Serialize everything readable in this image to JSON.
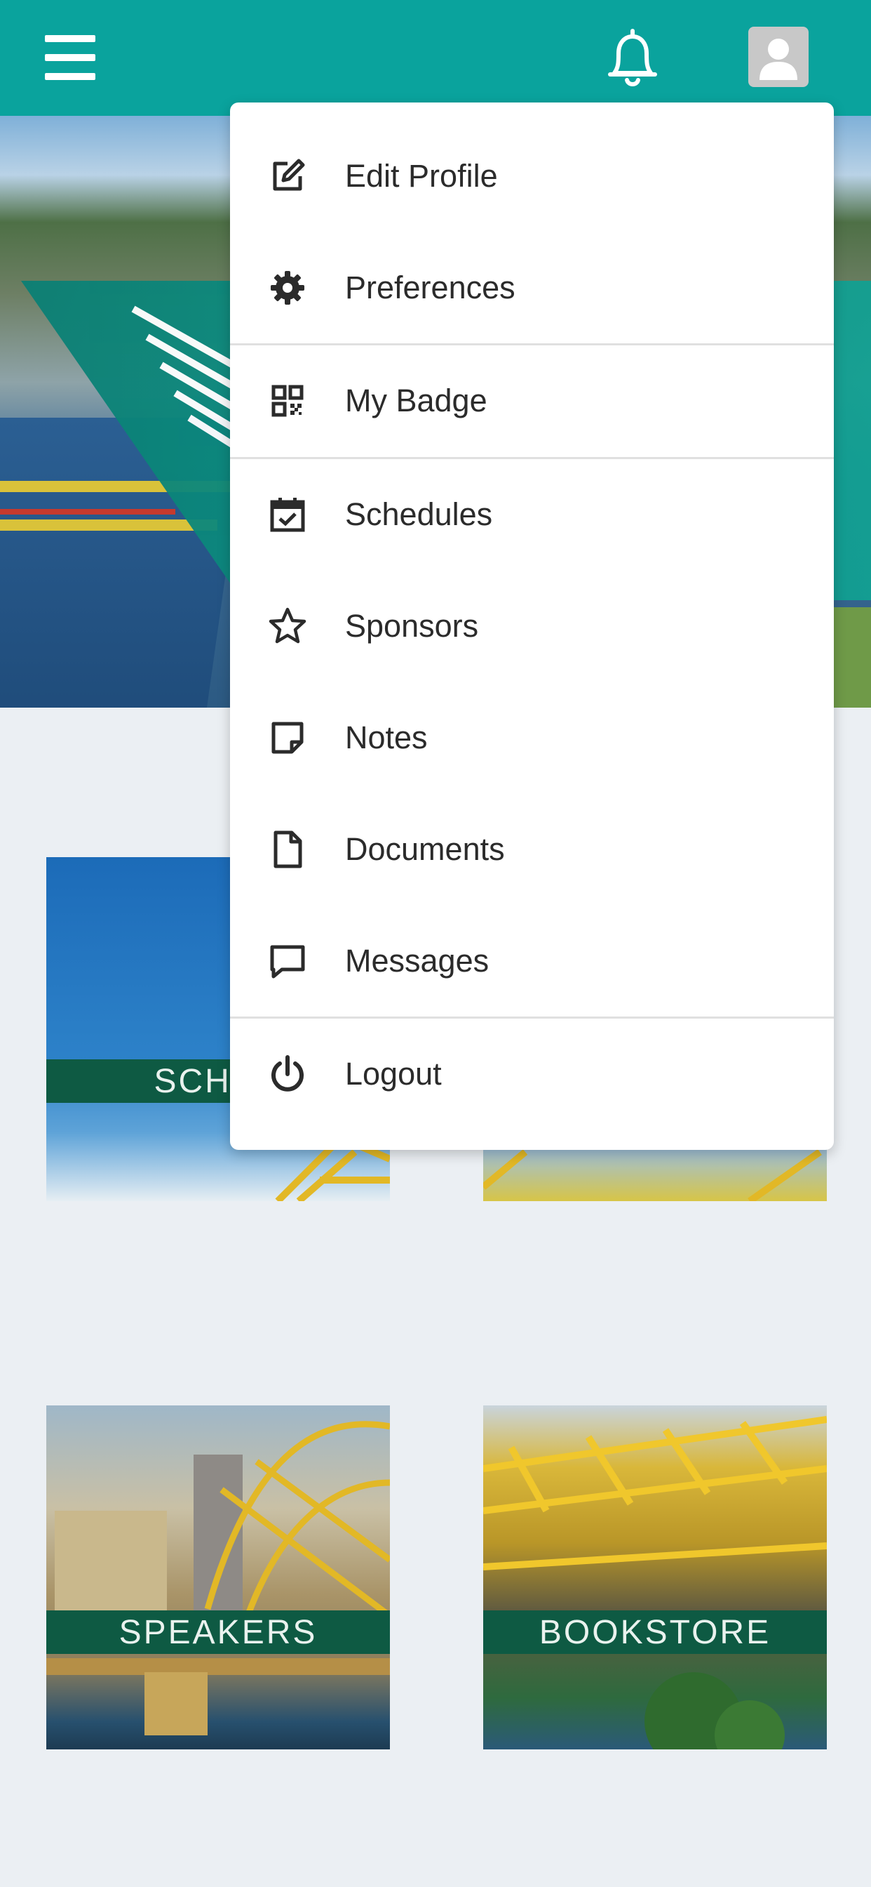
{
  "header": {
    "menu_icon": "hamburger-icon",
    "notifications_icon": "bell-icon",
    "profile_icon": "user-avatar-icon",
    "background_color": "#0aa39d"
  },
  "profile_menu": {
    "items": [
      {
        "label": "Edit Profile",
        "icon": "edit-icon"
      },
      {
        "label": "Preferences",
        "icon": "gear-icon"
      },
      {
        "label": "My Badge",
        "icon": "qr-code-icon"
      },
      {
        "label": "Schedules",
        "icon": "calendar-check-icon"
      },
      {
        "label": "Sponsors",
        "icon": "star-icon"
      },
      {
        "label": "Notes",
        "icon": "sticky-note-icon"
      },
      {
        "label": "Documents",
        "icon": "document-icon"
      },
      {
        "label": "Messages",
        "icon": "message-icon"
      },
      {
        "label": "Logout",
        "icon": "power-icon"
      }
    ]
  },
  "tiles": [
    {
      "label": "SCHED"
    },
    {
      "label": ""
    },
    {
      "label": "SPEAKERS"
    },
    {
      "label": "BOOKSTORE"
    }
  ],
  "colors": {
    "accent": "#0aa39d",
    "tile_label_bg": "#0e5a43",
    "page_bg": "#ebeff3"
  }
}
